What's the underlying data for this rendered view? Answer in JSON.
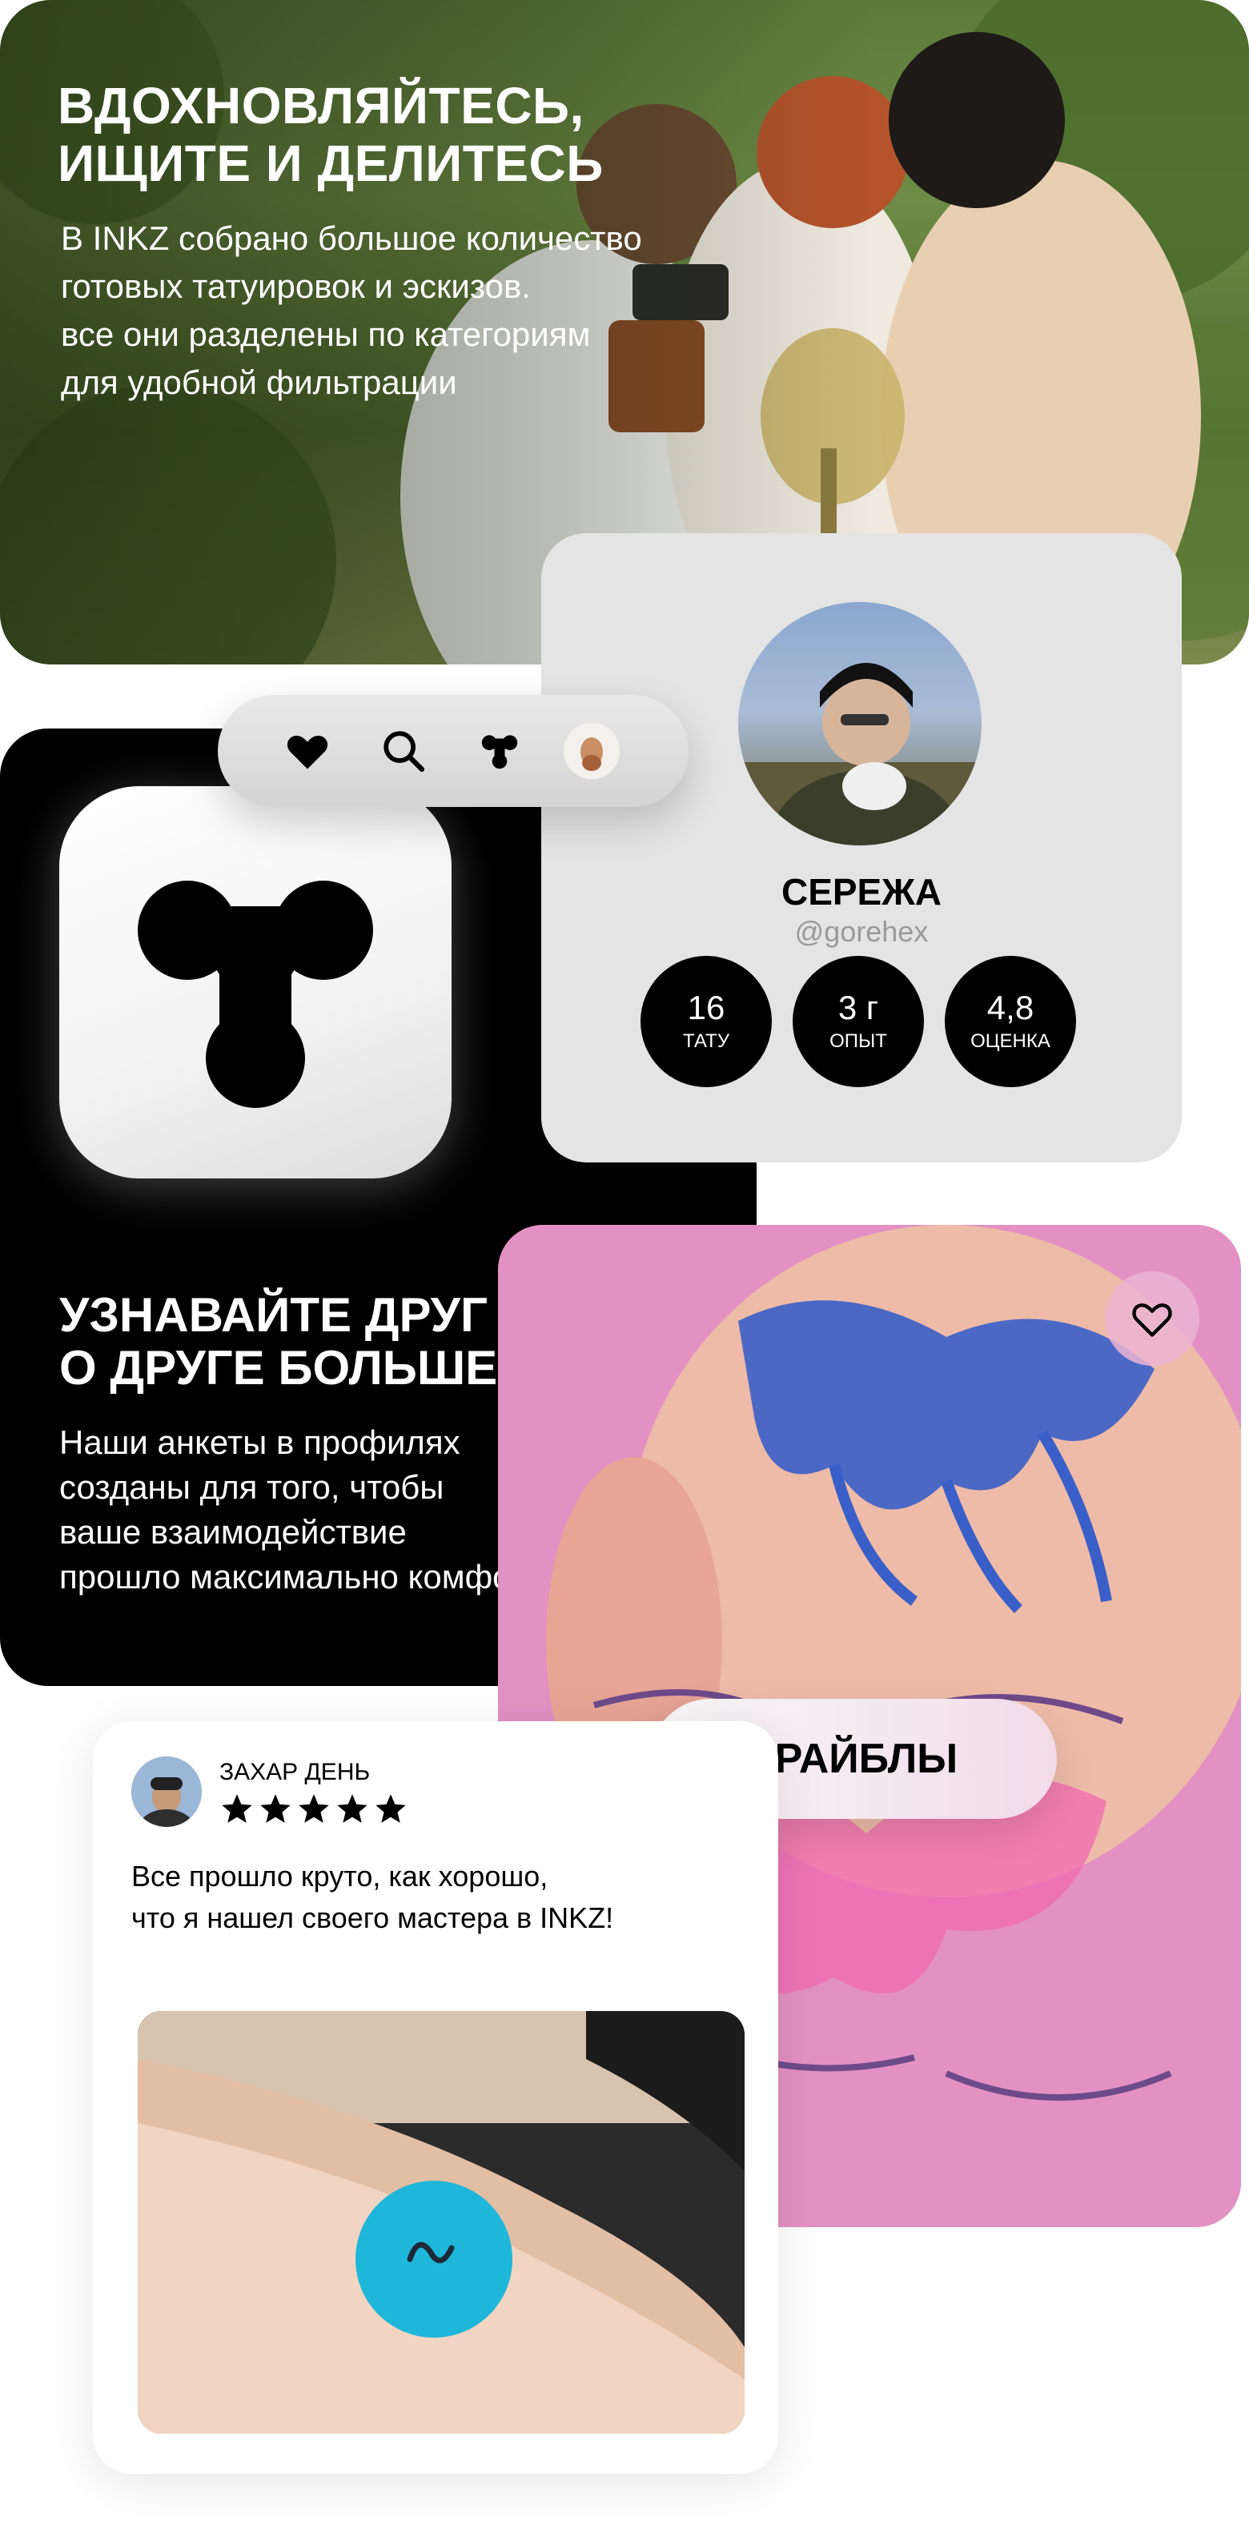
{
  "hero": {
    "title": "ВДОХНОВЛЯЙТЕСЬ,\nИЩИТЕ И ДЕЛИТЕСЬ",
    "body": "В INKZ собрано большое количество\nготовых татуировок и эскизов.\nвсе они разделены по категориям\nдля удобной фильтрации"
  },
  "nav": {
    "items": [
      {
        "icon": "heart-icon"
      },
      {
        "icon": "search-icon"
      },
      {
        "icon": "inkz-logo-icon"
      },
      {
        "icon": "user-avatar"
      }
    ]
  },
  "feature": {
    "title": "УЗНАВАЙТЕ ДРУГ\nО ДРУГЕ БОЛЬШЕ",
    "body": "Наши анкеты в профилях\nсозданы для того, чтобы\nваше взаимодействие\nпрошло максимально комфортно"
  },
  "profile": {
    "name": "СЕРЕЖА",
    "handle": "@gorehex",
    "stats": [
      {
        "value": "16",
        "label": "ТАТУ"
      },
      {
        "value": "3 г",
        "label": "ОПЫТ"
      },
      {
        "value": "4,8",
        "label": "ОЦЕНКА"
      }
    ]
  },
  "tattoo": {
    "tag": "ТРАЙБЛЫ",
    "favorite_icon": "heart-outline-icon"
  },
  "review": {
    "author": "ЗАХАР ДЕНЬ",
    "rating": 5,
    "text": "Все прошло круто, как хорошо,\nчто я нашел своего мастера в INKZ!"
  },
  "colors": {
    "accent_black": "#000000",
    "card_gray": "#e4e4e4",
    "tattoo_pink": "#e38fbf",
    "tattoo_blue": "#3a5fc8",
    "review_tattoo_cyan": "#1fb7d9"
  }
}
